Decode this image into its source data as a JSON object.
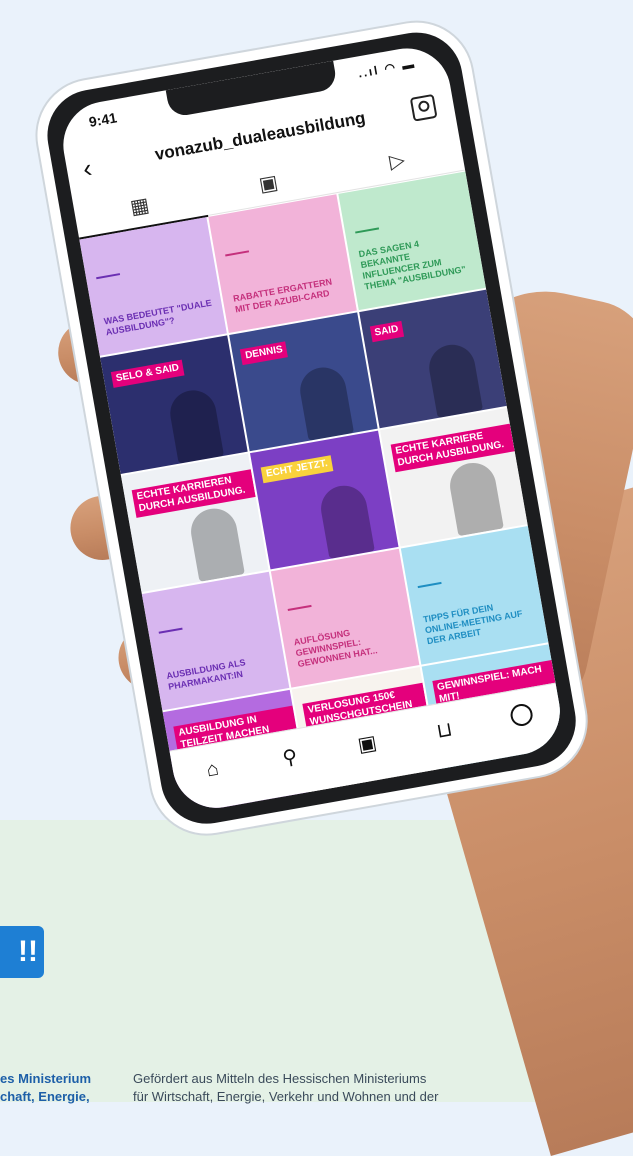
{
  "status_bar": {
    "time": "9:41",
    "signal": "..ıl ◠ ▬"
  },
  "profile": {
    "username": "vonazub_dualeausbildung"
  },
  "profile_tabs": [
    {
      "name": "tab-grid",
      "icon": "grid-icon",
      "glyph": "▦"
    },
    {
      "name": "tab-reels",
      "icon": "reels-icon",
      "glyph": "▣"
    },
    {
      "name": "tab-video",
      "icon": "play-icon",
      "glyph": "▷"
    }
  ],
  "posts": [
    {
      "bg": "#d7b6ef",
      "accent": "#6b2fb3",
      "text": "WAS BEDEUTET \"DUALE AUSBILDUNG\"?"
    },
    {
      "bg": "#f2b3d9",
      "accent": "#c5307c",
      "text": "RABATTE ERGATTERN MIT DER AZUBI-CARD"
    },
    {
      "bg": "#bfe9cd",
      "accent": "#2f9a58",
      "text": "DAS SAGEN 4 BEKANNTE INFLUENCER ZUM THEMA \"AUSBILDUNG\""
    },
    {
      "bg": "#2c2f6e",
      "accent": "#e4007c",
      "text": "SELO & SAID",
      "headline": "SELO & SAID"
    },
    {
      "bg": "#3a4a8c",
      "accent": "#e4007c",
      "text": "DENNIS",
      "headline": "DENNIS"
    },
    {
      "bg": "#3b3f77",
      "accent": "#e4007c",
      "text": "SAID",
      "headline": "SAID"
    },
    {
      "bg": "#eef1f5",
      "accent": "#e4007c",
      "text": "ECHT JETZT. ECHTE KARRIEREN DURCH AUSBILDUNG.",
      "headline": "ECHTE KARRIEREN DURCH AUSBILDUNG."
    },
    {
      "bg": "#7c3fc4",
      "accent": "#f9d23c",
      "text": "ECHT JETZT. ECHTE KARRIEREN",
      "headline": "ECHT JETZT."
    },
    {
      "bg": "#f2f2f2",
      "accent": "#e4007c",
      "text": "ECHT JETZT. ECHTE KARRIERE DURCH AUSBILDUNG.",
      "headline": "ECHTE KARRIERE DURCH AUSBILDUNG."
    },
    {
      "bg": "#d7b6ef",
      "accent": "#6b2fb3",
      "text": "AUSBILDUNG ALS PHARMAKANT:IN"
    },
    {
      "bg": "#f2b3d9",
      "accent": "#c5307c",
      "text": "AUFLÖSUNG GEWINNSPIEL: GEWONNEN HAT..."
    },
    {
      "bg": "#a9dff2",
      "accent": "#1f8ec2",
      "text": "TIPPS FÜR DEIN ONLINE-MEETING AUF DER ARBEIT"
    },
    {
      "bg": "#b46be0",
      "accent": "#e4007c",
      "text": "AUSBILDUNG IN TEILZEIT MACHEN",
      "headline": "AUSBILDUNG IN TEILZEIT MACHEN"
    },
    {
      "bg": "#f7f3ee",
      "accent": "#e4007c",
      "text": "VERLOSUNG 150€ WUNSCHGUTSCHEIN",
      "headline": "VERLOSUNG 150€ WUNSCHGUTSCHEIN"
    },
    {
      "bg": "#a9dff2",
      "accent": "#e4007c",
      "text": "GEWINNSPIEL: MACH MIT!",
      "headline": "GEWINNSPIEL: MACH MIT!"
    }
  ],
  "bottom_nav": [
    {
      "name": "home-icon",
      "glyph": "⌂"
    },
    {
      "name": "search-icon",
      "glyph": "⚲"
    },
    {
      "name": "reels-icon",
      "glyph": "▣"
    },
    {
      "name": "shop-icon",
      "glyph": "⊔"
    },
    {
      "name": "profile-icon",
      "glyph": ""
    }
  ],
  "badge": {
    "text": "!!"
  },
  "footer": {
    "partial_line1": "es Ministerium",
    "partial_line2": "chaft, Energie,",
    "funding_line1": "Gefördert aus Mitteln des Hessischen Ministeriums",
    "funding_line2": "für Wirtschaft, Energie, Verkehr und Wohnen und der"
  },
  "colors": {
    "page_bg": "#eaf2fb",
    "green_bg": "#e4f1e6",
    "brand_blue": "#1e7fd4",
    "phone_frame": "#1c1d1f"
  }
}
